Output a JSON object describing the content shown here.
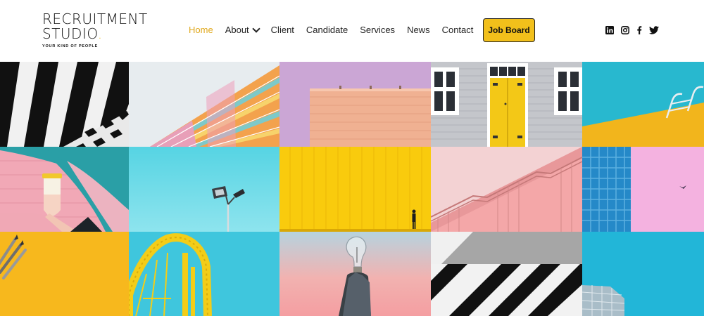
{
  "brand": {
    "line1": "RECRUITMENT",
    "line2": "STUDIO",
    "dot": ".",
    "tagline": "YOUR KIND OF PEOPLE",
    "accent_color": "#e8b811"
  },
  "nav": {
    "items": [
      {
        "label": "Home",
        "active": true
      },
      {
        "label": "About",
        "has_dropdown": true
      },
      {
        "label": "Client"
      },
      {
        "label": "Candidate"
      },
      {
        "label": "Services"
      },
      {
        "label": "News"
      },
      {
        "label": "Contact"
      }
    ],
    "cta": {
      "label": "Job Board",
      "color": "#f2c01b"
    },
    "active_color": "#e0a81c"
  },
  "social": [
    "linkedin-icon",
    "instagram-icon",
    "facebook-icon",
    "twitter-icon"
  ],
  "gallery": {
    "tiles": [
      "black-white-stripes-photo",
      "pastel-building-balconies-photo",
      "peach-wall-lilac-sky-photo",
      "yellow-door-grey-facade-photo",
      "blue-pool-ladder-photo",
      "hand-holding-cup-photo",
      "street-lamp-blue-sky-photo",
      "yellow-wall-figure-photo",
      "pink-staircase-railing-photo",
      "blue-glass-pink-wall-photo",
      "pencils-on-yellow-photo",
      "yellow-rollercoaster-photo",
      "hand-holding-lightbulb-photo",
      "concrete-striped-wall-photo",
      "blue-sky-building-photo"
    ]
  }
}
